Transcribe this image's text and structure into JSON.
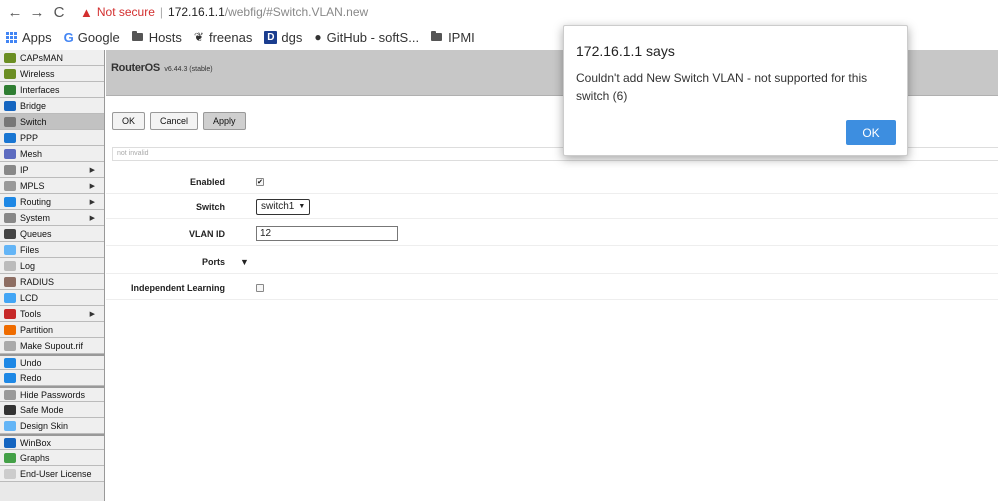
{
  "browser": {
    "not_secure": "Not secure",
    "separator": "|",
    "url_host": "172.16.1.1",
    "url_path": "/webfig/#Switch.VLAN.new",
    "bookmarks": [
      "Apps",
      "Google",
      "Hosts",
      "freenas",
      "dgs",
      "GitHub - softS...",
      "IPMI"
    ]
  },
  "sidebar": {
    "items": [
      {
        "label": "CAPsMAN",
        "icon": "antenna-icon",
        "color": "#6b8e23",
        "arrow": false
      },
      {
        "label": "Wireless",
        "icon": "antenna-icon",
        "color": "#6b8e23",
        "arrow": false
      },
      {
        "label": "Interfaces",
        "icon": "interfaces-icon",
        "color": "#2e7d32",
        "arrow": false
      },
      {
        "label": "Bridge",
        "icon": "bridge-icon",
        "color": "#1565c0",
        "arrow": false
      },
      {
        "label": "Switch",
        "icon": "switch-icon",
        "color": "#777777",
        "arrow": false,
        "active": true
      },
      {
        "label": "PPP",
        "icon": "ppp-icon",
        "color": "#1976d2",
        "arrow": false
      },
      {
        "label": "Mesh",
        "icon": "mesh-icon",
        "color": "#5c6bc0",
        "arrow": false
      },
      {
        "label": "IP",
        "icon": "ip-icon",
        "color": "#888888",
        "arrow": true
      },
      {
        "label": "MPLS",
        "icon": "mpls-icon",
        "color": "#999999",
        "arrow": true
      },
      {
        "label": "Routing",
        "icon": "routing-icon",
        "color": "#1e88e5",
        "arrow": true
      },
      {
        "label": "System",
        "icon": "gear-icon",
        "color": "#888888",
        "arrow": true
      },
      {
        "label": "Queues",
        "icon": "queues-icon",
        "color": "#444444",
        "arrow": false
      },
      {
        "label": "Files",
        "icon": "files-icon",
        "color": "#64b5f6",
        "arrow": false
      },
      {
        "label": "Log",
        "icon": "log-icon",
        "color": "#bbbbbb",
        "arrow": false
      },
      {
        "label": "RADIUS",
        "icon": "radius-icon",
        "color": "#8d6e63",
        "arrow": false
      },
      {
        "label": "LCD",
        "icon": "lcd-icon",
        "color": "#42a5f5",
        "arrow": false
      },
      {
        "label": "Tools",
        "icon": "tools-icon",
        "color": "#c62828",
        "arrow": true
      },
      {
        "label": "Partition",
        "icon": "partition-icon",
        "color": "#ef6c00",
        "arrow": false
      },
      {
        "label": "Make Supout.rif",
        "icon": "file-icon",
        "color": "#aaaaaa",
        "arrow": false
      },
      {
        "label": "Undo",
        "icon": "undo-icon",
        "color": "#1e88e5",
        "arrow": false,
        "group": true
      },
      {
        "label": "Redo",
        "icon": "redo-icon",
        "color": "#1e88e5",
        "arrow": false
      },
      {
        "label": "Hide Passwords",
        "icon": "password-icon",
        "color": "#999999",
        "arrow": false,
        "group": true
      },
      {
        "label": "Safe Mode",
        "icon": "umbrella-icon",
        "color": "#333333",
        "arrow": false
      },
      {
        "label": "Design Skin",
        "icon": "skin-icon",
        "color": "#64b5f6",
        "arrow": false
      },
      {
        "label": "WinBox",
        "icon": "winbox-icon",
        "color": "#1565c0",
        "arrow": false,
        "group": true
      },
      {
        "label": "Graphs",
        "icon": "graphs-icon",
        "color": "#43a047",
        "arrow": false
      },
      {
        "label": "End-User License",
        "icon": "license-icon",
        "color": "#cccccc",
        "arrow": false
      }
    ]
  },
  "main": {
    "title": "RouterOS",
    "version": "v6.44.3 (stable)",
    "buttons": {
      "ok": "OK",
      "cancel": "Cancel",
      "apply": "Apply"
    },
    "status_text": "not invalid",
    "form": {
      "enabled_label": "Enabled",
      "enabled_value": "✔",
      "switch_label": "Switch",
      "switch_value": "switch1",
      "vlan_label": "VLAN ID",
      "vlan_value": "12",
      "ports_label": "Ports",
      "independent_label": "Independent Learning",
      "independent_value": ""
    }
  },
  "dialog": {
    "title": "172.16.1.1 says",
    "message": "Couldn't add New Switch VLAN - not supported for this switch (6)",
    "ok_label": "OK"
  }
}
